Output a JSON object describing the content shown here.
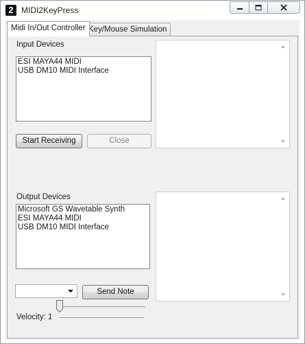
{
  "window": {
    "title": "MIDI2KeyPress",
    "icon_glyph": "2",
    "controls": [
      "minimize-icon",
      "maximize-icon",
      "close-icon"
    ]
  },
  "tabs": [
    {
      "label": "Midi In/Out Controller",
      "selected": true
    },
    {
      "label": "Key/Mouse Simulation",
      "selected": false
    }
  ],
  "input": {
    "label": "Input Devices",
    "devices": [
      "ESI MAYA44 MIDI",
      "USB DM10 MIDI Interface"
    ],
    "start_button": "Start Receiving",
    "close_button": "Close",
    "close_enabled": false
  },
  "output": {
    "label": "Output Devices",
    "devices": [
      "Microsoft GS Wavetable Synth",
      "ESI MAYA44 MIDI",
      "USB DM10 MIDI Interface"
    ],
    "note_select_value": "",
    "send_button": "Send Note"
  },
  "velocity": {
    "label": "Velocity: 1",
    "value": 1
  }
}
